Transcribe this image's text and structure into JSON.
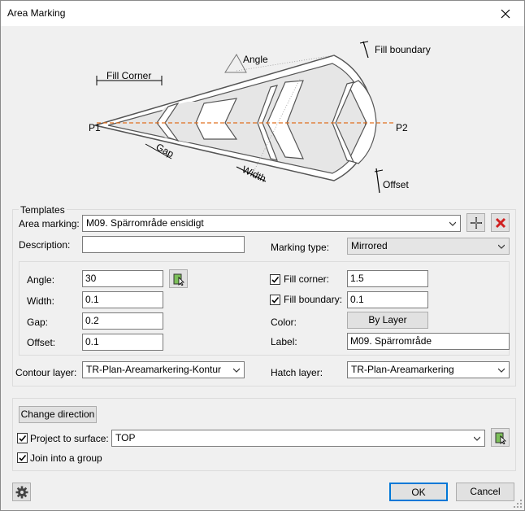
{
  "window": {
    "title": "Area Marking"
  },
  "diagram": {
    "labels": {
      "fill_corner": "Fill Corner",
      "angle": "Angle",
      "fill_boundary": "Fill boundary",
      "p1": "P1",
      "p2": "P2",
      "gap": "Gap",
      "width": "Width",
      "offset": "Offset"
    }
  },
  "templates": {
    "legend": "Templates",
    "area_marking_label": "Area marking:",
    "area_marking_value": "M09. Spärrområde ensidigt",
    "description_label": "Description:",
    "description_value": "",
    "marking_type_label": "Marking type:",
    "marking_type_value": "Mirrored",
    "angle_label": "Angle:",
    "angle_value": "30",
    "width_label": "Width:",
    "width_value": "0.1",
    "gap_label": "Gap:",
    "gap_value": "0.2",
    "offset_label": "Offset:",
    "offset_value": "0.1",
    "fill_corner_label": "Fill corner:",
    "fill_corner_value": "1.5",
    "fill_corner_checked": true,
    "fill_boundary_label": "Fill boundary:",
    "fill_boundary_value": "0.1",
    "fill_boundary_checked": true,
    "color_label": "Color:",
    "color_button": "By Layer",
    "label_label": "Label:",
    "label_value": "M09. Spärrområde",
    "contour_layer_label": "Contour layer:",
    "contour_layer_value": "TR-Plan-Areamarkering-Kontur",
    "hatch_layer_label": "Hatch layer:",
    "hatch_layer_value": "TR-Plan-Areamarkering"
  },
  "options": {
    "change_direction": "Change direction",
    "project_to_surface_label": "Project to surface:",
    "project_to_surface_checked": true,
    "surface_value": "TOP",
    "join_group_label": "Join into a group",
    "join_group_checked": true
  },
  "footer": {
    "ok": "OK",
    "cancel": "Cancel"
  },
  "icons": {
    "add": "plus-icon",
    "delete": "red-x-icon",
    "pick": "pick-point-icon",
    "settings": "gear-icon"
  }
}
